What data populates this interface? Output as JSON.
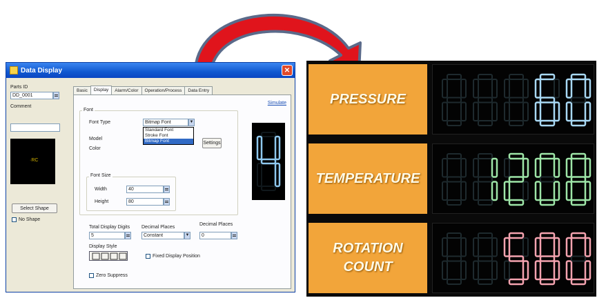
{
  "colors": {
    "arrow_fill": "#e0141c",
    "arrow_outline": "#5a6a8a",
    "panel_bg": "#f2a53a",
    "digit_off": "#1e2a2e",
    "pressure_digit": "#a9d9f5",
    "temperature_digit": "#9ee6a8",
    "rotation_digit": "#f5a3b0",
    "preview_digit": "#8fc8ee"
  },
  "dialog": {
    "title": "Data Display",
    "parts_id_label": "Parts ID",
    "parts_id_value": "DD_0001",
    "comment_label": "Comment",
    "select_shape_label": "Select Shape",
    "no_shape_label": "No Shape",
    "tabs": [
      "Basic",
      "Display",
      "Alarm/Color",
      "Operation/Process",
      "Data Entry"
    ],
    "simulate_link": "Simulate",
    "font_group": "Font",
    "font_type_label": "Font Type",
    "font_type_value": "Bitmap Font",
    "model_label": "Model",
    "color_label": "Color",
    "font_options": [
      "Standard Font",
      "Stroke Font",
      "Bitmap Font"
    ],
    "settings_button": "Settings",
    "font_size_group": "Font Size",
    "width_label": "Width",
    "width_value": "40",
    "height_label": "Height",
    "height_value": "80",
    "total_digits_label": "Total Display Digits",
    "total_digits_value": "5",
    "decimal_places_label": "Decimal Places",
    "decimal_places_value": "Constant",
    "decimal_places2_label": "Decimal Places",
    "decimal_places2_value": "0",
    "display_style_label": "Display Style",
    "fixed_position_label": "Fixed Display Position",
    "zero_suppress_label": "Zero Suppress",
    "preview_digit": "4"
  },
  "display_rows": [
    {
      "label": "PRESSURE",
      "digits": 5,
      "value": "60",
      "color_key": "pressure_digit"
    },
    {
      "label": "TEMPERATURE",
      "digits": 5,
      "value": "1208",
      "color_key": "temperature_digit"
    },
    {
      "label": "ROTATION\nCOUNT",
      "digits": 5,
      "value": "580",
      "color_key": "rotation_digit"
    }
  ]
}
